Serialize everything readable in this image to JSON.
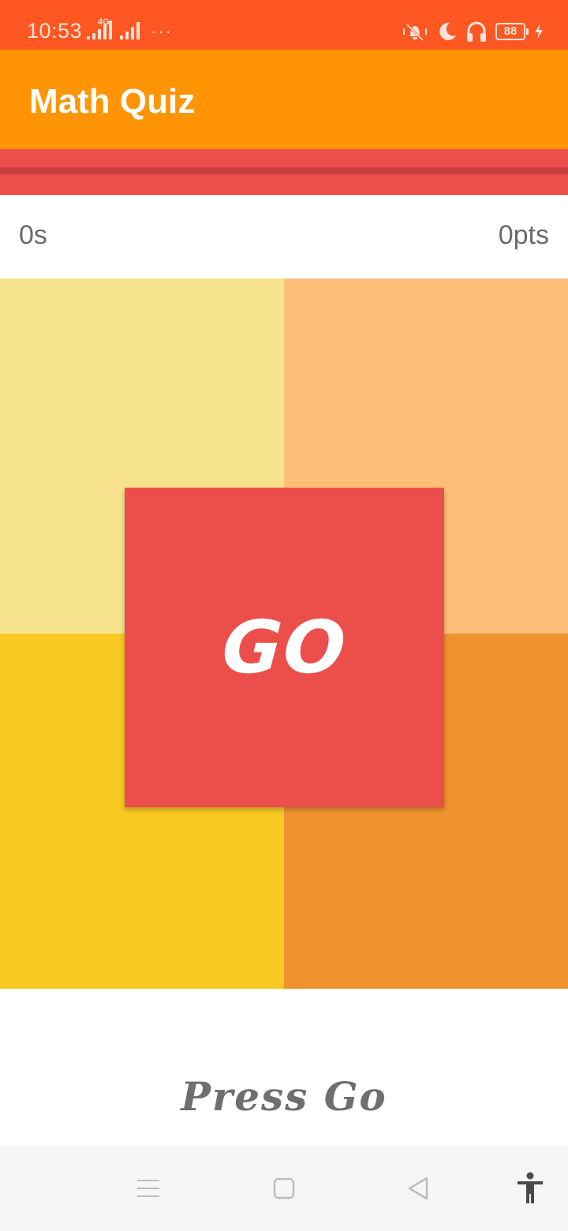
{
  "status_bar": {
    "time": "10:53",
    "network_label": "4G",
    "battery_level": "88",
    "background_color": "#ff5722",
    "icons": [
      "signal-icon",
      "signal-icon",
      "more-dots-icon",
      "vibrate-icon",
      "do-not-disturb-icon",
      "headphones-icon",
      "battery-icon",
      "charging-icon"
    ]
  },
  "app_bar": {
    "title": "Math Quiz",
    "background_color": "#ff9505"
  },
  "timer_bar": {
    "background_color": "#ec4e4b"
  },
  "stats": {
    "time": "0s",
    "points": "0pts"
  },
  "answer_tiles": [
    {
      "position": "top-left",
      "color": "#f6e28d"
    },
    {
      "position": "top-right",
      "color": "#fdbe79"
    },
    {
      "position": "bottom-left",
      "color": "#f8c823"
    },
    {
      "position": "bottom-right",
      "color": "#f0922e"
    }
  ],
  "go_button": {
    "label": "GO",
    "color": "#ec4e4b"
  },
  "prompt": "Press Go",
  "nav_bar": {
    "icons": [
      "menu-icon",
      "home-icon",
      "back-icon",
      "accessibility-icon"
    ]
  }
}
